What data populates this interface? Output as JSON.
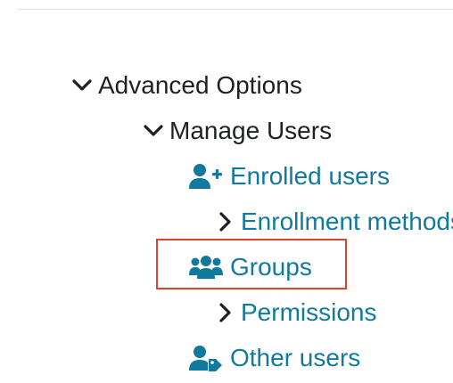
{
  "tree": {
    "advanced_options": "Advanced Options",
    "manage_users": "Manage Users",
    "enrolled_users": "Enrolled users",
    "enrollment_methods": "Enrollment methods",
    "groups": "Groups",
    "permissions": "Permissions",
    "other_users": "Other users"
  },
  "icons": {
    "expanded": "chevron-down-icon",
    "collapsed": "chevron-right-icon",
    "enrolled_users": "user-plus-icon",
    "groups": "users-icon",
    "other_users": "user-tag-icon"
  },
  "colors": {
    "text": "#1d2125",
    "link": "#117a9c",
    "highlight": "#e0442c",
    "divider": "#e6e6e6"
  }
}
